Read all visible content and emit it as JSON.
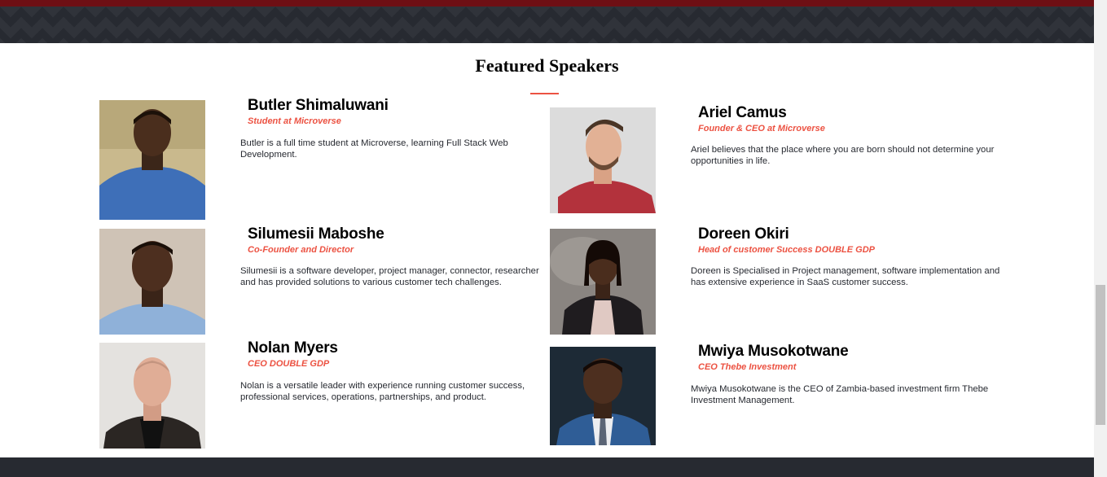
{
  "section": {
    "title": "Featured Speakers"
  },
  "colors": {
    "accent": "#ec5242",
    "dark": "#272a31",
    "top_strip": "#6e0f14"
  },
  "speakers": [
    {
      "name": "Butler Shimaluwani",
      "role": "Student at Microverse",
      "bio": "Butler is a full time student at Microverse, learning Full Stack Web Development."
    },
    {
      "name": "Ariel Camus",
      "role": "Founder & CEO at Microverse",
      "bio": "Ariel believes that the place where you are born should not determine your opportunities in life."
    },
    {
      "name": "Silumesii Maboshe",
      "role": "Co-Founder and Director",
      "bio": "Silumesii is a software developer, project manager, connector, researcher and has provided solutions to various customer tech challenges."
    },
    {
      "name": "Doreen Okiri",
      "role": "Head of customer Success DOUBLE GDP",
      "bio": "Doreen is Specialised in Project management, software implementation and has extensive experience in SaaS customer success."
    },
    {
      "name": "Nolan Myers",
      "role": "CEO DOUBLE GDP",
      "bio": "Nolan is a versatile leader with experience running customer success, professional services, operations, partnerships, and product."
    },
    {
      "name": "Mwiya Musokotwane",
      "role": "CEO Thebe Investment",
      "bio": "Mwiya Musokotwane is the CEO of Zambia-based investment firm Thebe Investment Management."
    }
  ]
}
